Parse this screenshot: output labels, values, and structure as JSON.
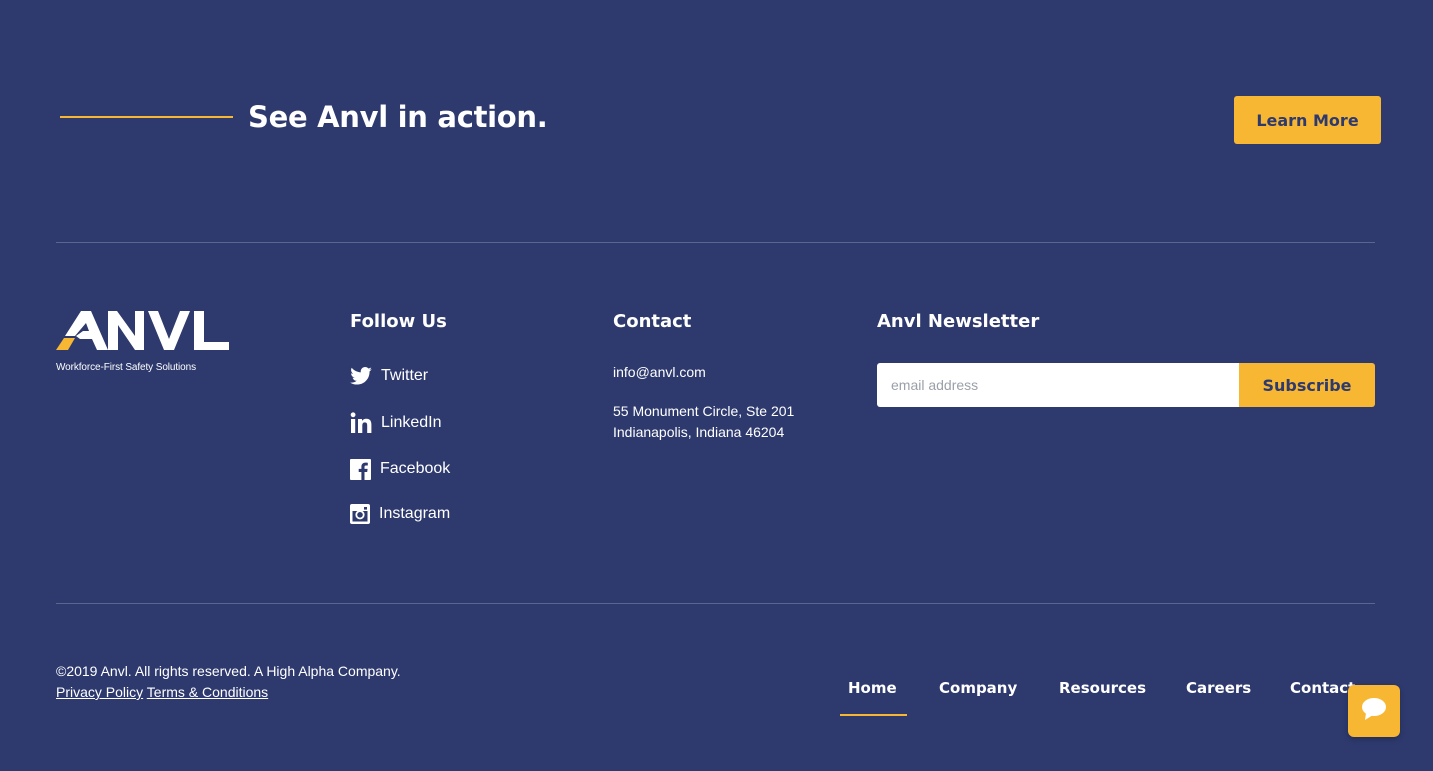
{
  "cta": {
    "heading": "See Anvl in action.",
    "button_label": "Learn More"
  },
  "logo": {
    "text": "ANVL",
    "tagline": "Workforce-First Safety Solutions"
  },
  "follow": {
    "heading": "Follow Us",
    "items": [
      {
        "label": "Twitter",
        "icon": "twitter-icon"
      },
      {
        "label": "LinkedIn",
        "icon": "linkedin-icon"
      },
      {
        "label": "Facebook",
        "icon": "facebook-icon"
      },
      {
        "label": "Instagram",
        "icon": "instagram-icon"
      }
    ]
  },
  "contact": {
    "heading": "Contact",
    "email": "info@anvl.com",
    "address_line1": "55 Monument Circle, Ste 201",
    "address_line2": "Indianapolis, Indiana 46204"
  },
  "newsletter": {
    "heading": "Anvl Newsletter",
    "placeholder": "email address",
    "button_label": "Subscribe"
  },
  "footer": {
    "copyright": "©2019 Anvl. All rights reserved. A High Alpha Company.",
    "privacy_label": "Privacy Policy",
    "terms_label": "Terms & Conditions",
    "nav": [
      {
        "label": "Home",
        "active": true
      },
      {
        "label": "Company"
      },
      {
        "label": "Resources"
      },
      {
        "label": "Careers"
      },
      {
        "label": "Contact"
      }
    ]
  },
  "colors": {
    "background": "#2e3a6e",
    "accent": "#f7b733",
    "text": "#ffffff"
  },
  "chat": {
    "icon": "chat-bubble-icon"
  }
}
